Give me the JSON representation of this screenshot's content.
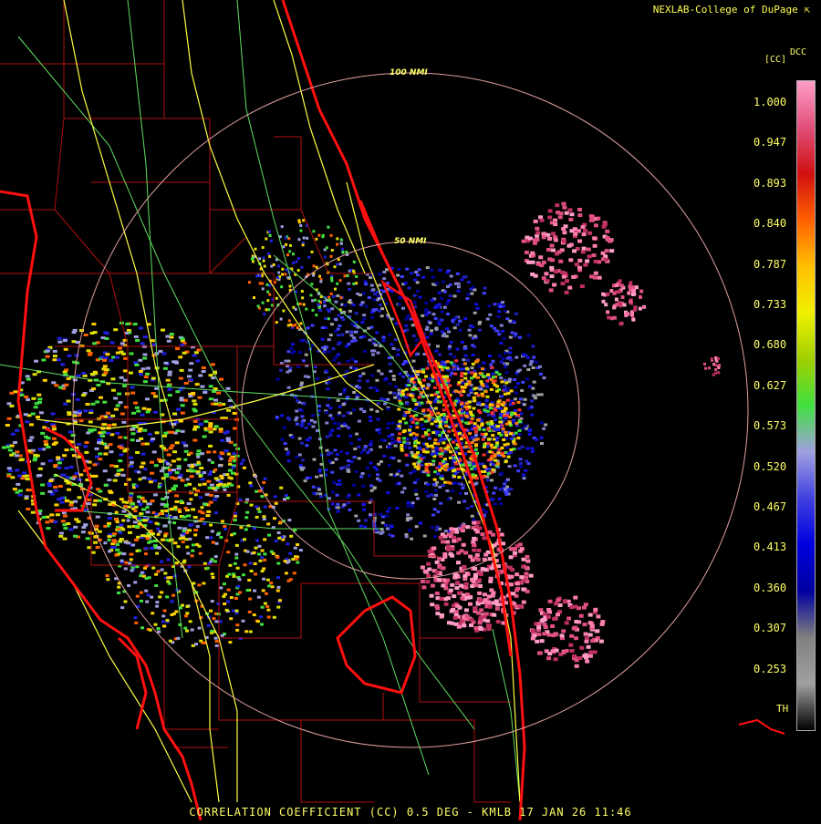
{
  "header": {
    "credit": "NEXLAB-College of DuPage"
  },
  "footer": {
    "product": "CORRELATION COEFFICIENT (CC) 0.5 DEG - KMLB 17 JAN 26 11:46"
  },
  "legend": {
    "title": "[CC]",
    "unit": "DCC",
    "threshold_label": "TH",
    "ticks": [
      "1.000",
      "0.947",
      "0.893",
      "0.840",
      "0.787",
      "0.733",
      "0.680",
      "0.627",
      "0.573",
      "0.520",
      "0.467",
      "0.413",
      "0.360",
      "0.307",
      "0.253"
    ],
    "color_stops": [
      "#ff9ec8",
      "#e0507a",
      "#d01010",
      "#ff6000",
      "#ffc000",
      "#f0f000",
      "#a0d000",
      "#40e040",
      "#a0a0e0",
      "#4040e0",
      "#0000e0",
      "#0000a0",
      "#808080",
      "#a0a0a0",
      "#000000"
    ]
  },
  "map": {
    "range_rings": [
      {
        "label": "50 NMI",
        "radius_nmi": 50
      },
      {
        "label": "100 NMI",
        "radius_nmi": 100
      }
    ],
    "colors": {
      "coast": "#ff1010",
      "county": "#b01010",
      "highway": "#ffff40",
      "road": "#60e060",
      "ring": "#e0a0a0"
    }
  }
}
